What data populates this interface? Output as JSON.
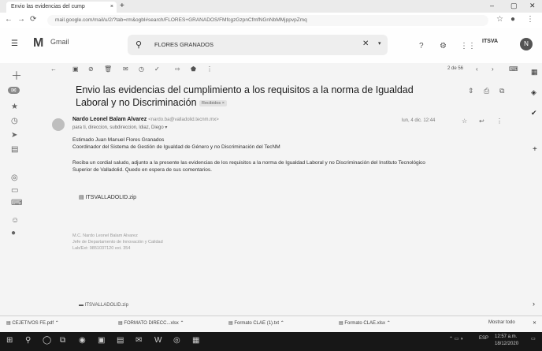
{
  "browser": {
    "tab_title": "Envio las evidencias del cump",
    "tab_close": "×",
    "new_tab": "+",
    "url": "mail.google.com/mail/u/2/?tab=rm&ogbl#search/FLORES+GRANADOS/FMfcgzGzpnCfmfNGnNbMMjppvpZmq"
  },
  "gmail": {
    "logo_text": "Gmail",
    "search_value": "FLORES GRANADOS",
    "account_badge": "ITSVA",
    "avatar_letter": "N",
    "pagination": "2 de 56"
  },
  "message": {
    "subject": "Envio las evidencias del cumplimiento a los requisitos a la norma de Igualdad Laboral y no Discriminación",
    "label": "Recibidos ×",
    "sender_name": "Nardo Leonel Balam Alvarez",
    "sender_email": "<nardo.ba@valladolid.tecnm.mx>",
    "to": "para ti, direccion, subdireccion, ldiaz, Diego",
    "date": "lun, 4 dic. 12:44",
    "greeting": "Estimado Juan Manuel Flores Granados",
    "role": "Coordinador del Sistema de Gestión de Igualdad de Género y no Discriminación del TecNM",
    "body_line1": "Reciba un cordial saludo, adjunto a la presente las evidencias de los requisitos a la norma de Igualdad Laboral y no Discriminación del Instituto Tecnológico",
    "body_line2": "Superior de Valladolid. Quedo en espera de sus comentarios.",
    "attachment": "ITSVALLADOLID.zip",
    "sig1": "M.C. Nardo Leonel Balam Alvarez",
    "sig2": "Jefe de Departamento de Innovación y Calidad",
    "sig3": "Lab/Ext: 9851037120 ext. 354",
    "attachment_bottom": "ITSVALLADOLID.zip"
  },
  "downloads": [
    "CEJETIVOS FE.pdf",
    "FORMATO DIRECC...xlsx",
    "Formato CLAE (1).txt",
    "Formato CLAE.xlsx"
  ],
  "downloads_showall": "Mostrar todo",
  "taskbar": {
    "time": "12:57 a.m.",
    "date": "18/12/2020",
    "lang": "ESP"
  }
}
